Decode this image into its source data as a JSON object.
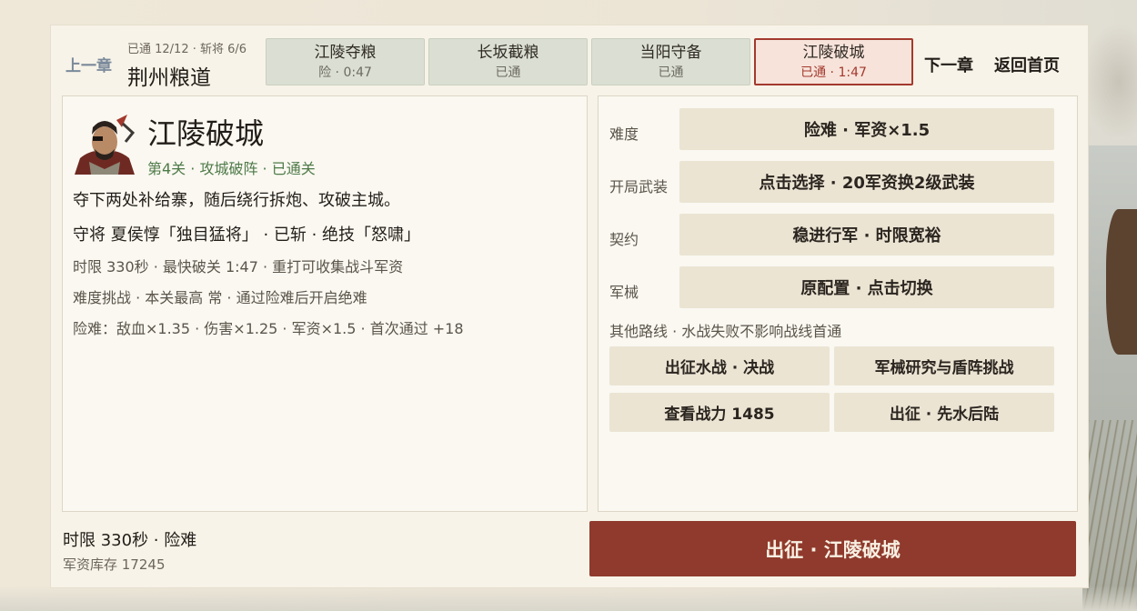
{
  "header": {
    "prev_chapter": "上一章",
    "progress": "已通 12/12 · 斩将 6/6",
    "route_title": "荆州粮道",
    "next_chapter": "下一章",
    "home": "返回首页"
  },
  "stages": [
    {
      "name": "江陵夺粮",
      "status": "险 · 0:47",
      "active": false
    },
    {
      "name": "长坂截粮",
      "status": "已通",
      "active": false
    },
    {
      "name": "当阳守备",
      "status": "已通",
      "active": false
    },
    {
      "name": "江陵破城",
      "status": "已通 · 1:47",
      "active": true
    }
  ],
  "detail": {
    "title": "江陵破城",
    "meta": "第4关 · 攻城破阵 · 已通关",
    "description": "夺下两处补给寨，随后绕行拆炮、攻破主城。",
    "general": "守将 夏侯惇「独目猛将」 · 已斩 · 绝技「怒啸」",
    "lines": [
      "时限 330秒 · 最快破关 1:47 · 重打可收集战斗军资",
      "难度挑战 · 本关最高 常 · 通过险难后开启绝难",
      "险难：敌血×1.35 · 伤害×1.25 · 军资×1.5 · 首次通过 +18"
    ]
  },
  "options": [
    {
      "label": "难度",
      "value": "险难 · 军资×1.5"
    },
    {
      "label": "开局武装",
      "value": "点击选择 · 20军资换2级武装"
    },
    {
      "label": "契约",
      "value": "稳进行军 · 时限宽裕"
    },
    {
      "label": "军械",
      "value": "原配置 · 点击切换"
    }
  ],
  "other_routes": {
    "label": "其他路线 · 水战失败不影响战线首通",
    "buttons": [
      "出征水战 · 决战",
      "军械研究与盾阵挑战",
      "查看战力 1485",
      "出征 · 先水后陆"
    ]
  },
  "footer": {
    "summary": "时限 330秒 · 险难",
    "funds": "军资库存 17245",
    "launch": "出征 · 江陵破城"
  },
  "colors": {
    "accent": "#8f3a2c",
    "active_border": "#a3392d",
    "meta_green": "#4e7a48",
    "stage_bg": "#dbdfd3",
    "button_bg": "#ebe4d3"
  }
}
